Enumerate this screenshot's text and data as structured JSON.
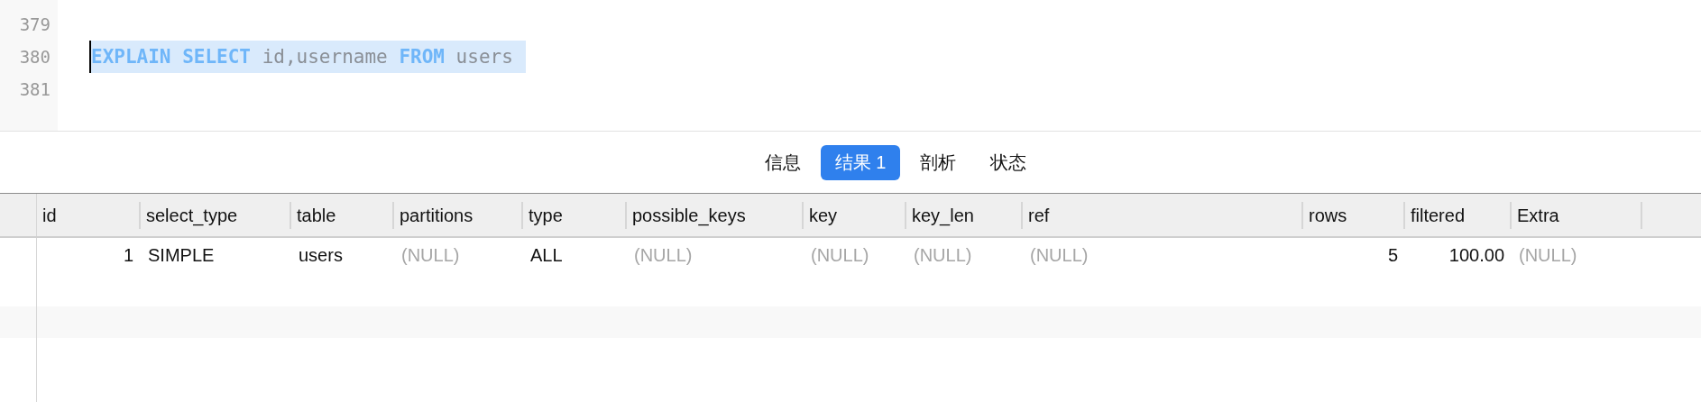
{
  "editor": {
    "lines": [
      {
        "number": "379"
      },
      {
        "number": "380",
        "selected": true,
        "cursor": true,
        "tokens": [
          {
            "kind": "keyword",
            "text": "EXPLAIN SELECT"
          },
          {
            "kind": "ident",
            "text": " id,username "
          },
          {
            "kind": "keyword",
            "text": "FROM"
          },
          {
            "kind": "ident",
            "text": " users"
          }
        ]
      },
      {
        "number": "381"
      }
    ]
  },
  "tabs": [
    {
      "label": "信息",
      "selected": false
    },
    {
      "label": "结果 1",
      "selected": true
    },
    {
      "label": "剖析",
      "selected": false
    },
    {
      "label": "状态",
      "selected": false
    }
  ],
  "table": {
    "columns": [
      {
        "label": "id",
        "numeric": true
      },
      {
        "label": "select_type",
        "numeric": false
      },
      {
        "label": "table",
        "numeric": false
      },
      {
        "label": "partitions",
        "numeric": false
      },
      {
        "label": "type",
        "numeric": false
      },
      {
        "label": "possible_keys",
        "numeric": false
      },
      {
        "label": "key",
        "numeric": false
      },
      {
        "label": "key_len",
        "numeric": false
      },
      {
        "label": "ref",
        "numeric": false
      },
      {
        "label": "rows",
        "numeric": true
      },
      {
        "label": "filtered",
        "numeric": true
      },
      {
        "label": "Extra",
        "numeric": false
      }
    ],
    "rows": [
      [
        {
          "text": "1",
          "null": false
        },
        {
          "text": "SIMPLE",
          "null": false
        },
        {
          "text": "users",
          "null": false
        },
        {
          "text": "(NULL)",
          "null": true
        },
        {
          "text": "ALL",
          "null": false
        },
        {
          "text": "(NULL)",
          "null": true
        },
        {
          "text": "(NULL)",
          "null": true
        },
        {
          "text": "(NULL)",
          "null": true
        },
        {
          "text": "(NULL)",
          "null": true
        },
        {
          "text": "5",
          "null": false
        },
        {
          "text": "100.00",
          "null": false
        },
        {
          "text": "(NULL)",
          "null": true
        }
      ]
    ]
  }
}
